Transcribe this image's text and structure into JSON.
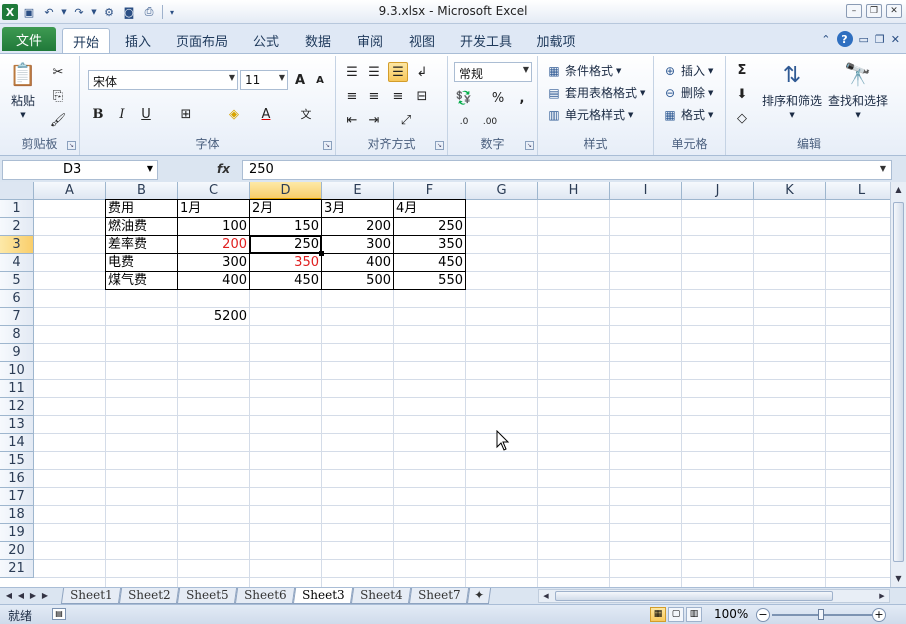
{
  "window": {
    "title": "9.3.xlsx - Microsoft Excel"
  },
  "ribbon_tabs": [
    "文件",
    "开始",
    "插入",
    "页面布局",
    "公式",
    "数据",
    "审阅",
    "视图",
    "开发工具",
    "加载项"
  ],
  "ribbon": {
    "clipboard": {
      "label": "剪贴板",
      "paste": "粘贴"
    },
    "font": {
      "label": "字体",
      "font_name": "宋体",
      "font_size": "11"
    },
    "alignment": {
      "label": "对齐方式"
    },
    "number": {
      "label": "数字",
      "format": "常规"
    },
    "styles": {
      "label": "样式",
      "conditional": "条件格式",
      "table": "套用表格格式",
      "cell": "单元格样式"
    },
    "cells": {
      "label": "单元格",
      "insert": "插入",
      "delete": "删除",
      "format": "格式"
    },
    "editing": {
      "label": "编辑",
      "sort": "排序和筛选",
      "find": "查找和选择"
    }
  },
  "formula_bar": {
    "name_box": "D3",
    "fx": "fx",
    "formula": "250"
  },
  "columns": [
    "A",
    "B",
    "C",
    "D",
    "E",
    "F",
    "G",
    "H",
    "I",
    "J",
    "K",
    "L"
  ],
  "active_column": "D",
  "rows": [
    "1",
    "2",
    "3",
    "4",
    "5",
    "6",
    "7",
    "8",
    "9",
    "10",
    "11",
    "12",
    "13",
    "14",
    "15",
    "16",
    "17",
    "18",
    "19",
    "20",
    "21"
  ],
  "active_row": "3",
  "cells": {
    "B1": "费用",
    "C1": "1月",
    "D1": "2月",
    "E1": "3月",
    "F1": "4月",
    "B2": "燃油费",
    "C2": "100",
    "D2": "150",
    "E2": "200",
    "F2": "250",
    "B3": "差率费",
    "C3": "200",
    "D3": "250",
    "E3": "300",
    "F3": "350",
    "B4": "电费",
    "C4": "300",
    "D4": "350",
    "E4": "400",
    "F4": "450",
    "B5": "煤气费",
    "C5": "400",
    "D5": "450",
    "E5": "500",
    "F5": "550",
    "C7": "5200"
  },
  "red_cells": [
    "C3",
    "D4"
  ],
  "colors": {
    "red_text": "#e02020",
    "active_header": "#f9ce6b",
    "file_tab": "#20793a"
  },
  "sheets": [
    "Sheet1",
    "Sheet2",
    "Sheet5",
    "Sheet6",
    "Sheet3",
    "Sheet4",
    "Sheet7"
  ],
  "active_sheet": "Sheet3",
  "status": {
    "ready": "就绪",
    "zoom": "100%"
  }
}
